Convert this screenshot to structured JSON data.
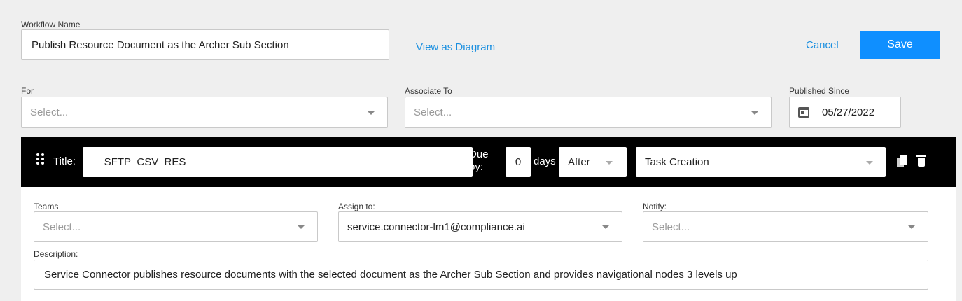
{
  "header": {
    "workflow_name_label": "Workflow Name",
    "workflow_name_value": "Publish Resource Document as the Archer Sub Section",
    "view_as_diagram": "View as Diagram",
    "cancel_label": "Cancel",
    "save_label": "Save"
  },
  "filters": {
    "for_label": "For",
    "for_placeholder": "Select...",
    "associate_label": "Associate To",
    "associate_placeholder": "Select...",
    "published_label": "Published Since",
    "published_value": "05/27/2022"
  },
  "task": {
    "title_label": "Title:",
    "title_value": "__SFTP_CSV_RES__",
    "due_label": "Due by:",
    "due_value": "0",
    "days_label": "days",
    "after_value": "After",
    "trigger_value": "Task Creation",
    "teams_label": "Teams",
    "teams_placeholder": "Select...",
    "assign_label": "Assign to:",
    "assign_value": "service.connector-lm1@compliance.ai",
    "notify_label": "Notify:",
    "notify_placeholder": "Select...",
    "description_label": "Description:",
    "description_value": "Service Connector publishes resource documents with the selected document as the Archer Sub Section and provides navigational nodes 3 levels up"
  },
  "colors": {
    "accent": "#0f8fff",
    "link": "#1a8fe0",
    "task_bar": "#000000",
    "background": "#efefef"
  },
  "icons": {
    "drag": "drag-handle-icon",
    "calendar": "calendar-icon",
    "copy": "copy-icon",
    "delete": "trash-icon",
    "dropdown": "chevron-down-icon"
  }
}
